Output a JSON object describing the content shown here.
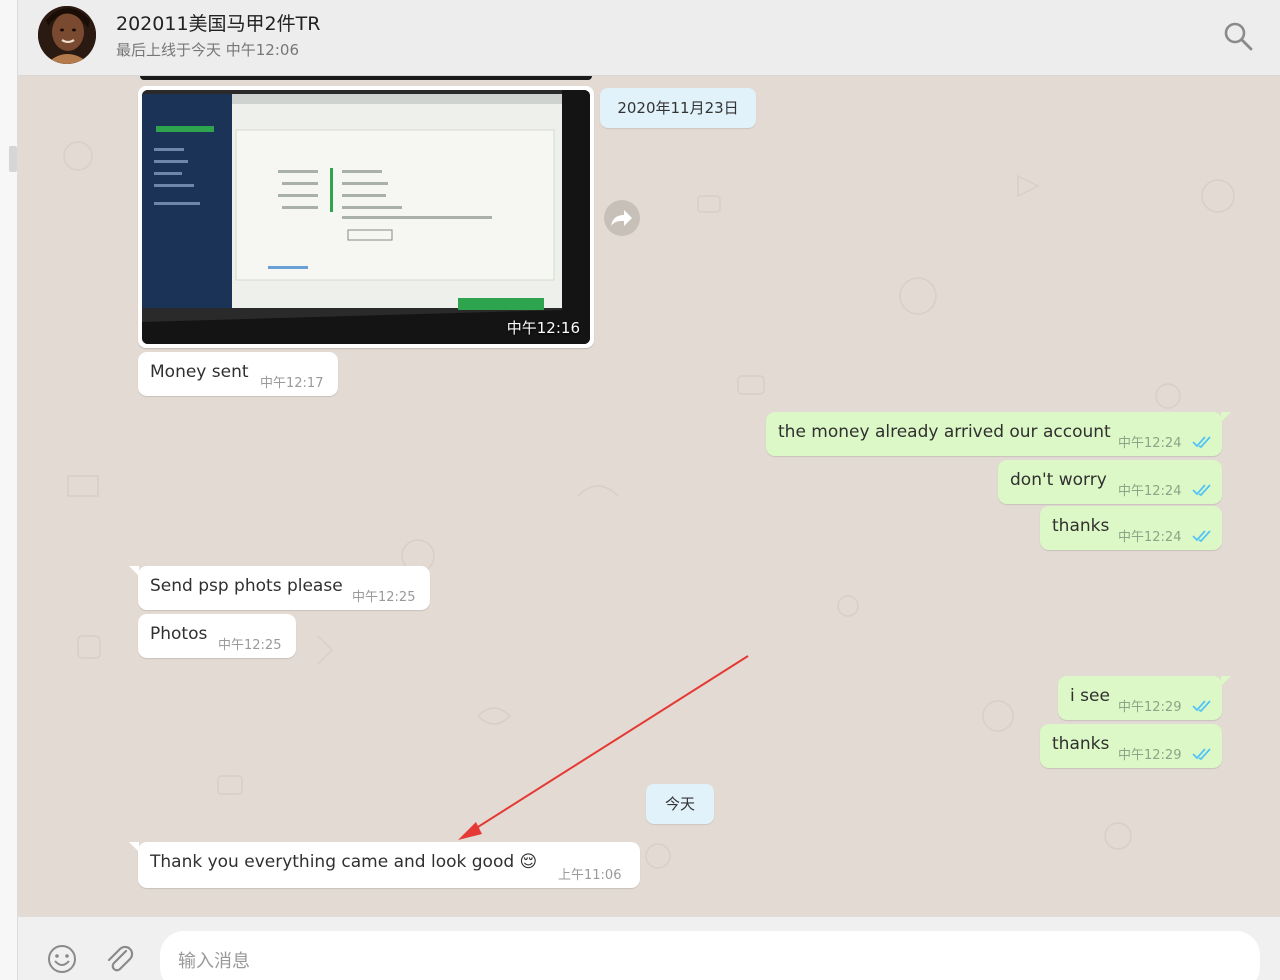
{
  "header": {
    "title": "202011美国马甲2件TR",
    "status": "最后上线于今天 中午12:06",
    "avatar_icon": "avatar-photo",
    "search_icon": "search-icon"
  },
  "messages": {
    "image_time": "中午12:16",
    "date1": "2020年11月23日",
    "m1_text": "Money sent",
    "m1_time": "中午12:17",
    "m2_text": "the money already arrived our account",
    "m2_time": "中午12:24",
    "m3_text": "don't worry",
    "m3_time": "中午12:24",
    "m4_text": "thanks",
    "m4_time": "中午12:24",
    "m5_text": "Send psp phots please",
    "m5_time": "中午12:25",
    "m6_text": "Photos",
    "m6_time": "中午12:25",
    "m7_text": "i see",
    "m7_time": "中午12:29",
    "m8_text": "thanks",
    "m8_time": "中午12:29",
    "date2": "今天",
    "m9_text": "Thank you everything came and look good 😌",
    "m9_time": "上午11:06"
  },
  "composer": {
    "placeholder": "输入消息",
    "emoji_icon": "emoji-icon",
    "attach_icon": "paperclip-icon"
  },
  "colors": {
    "chat_bg": "#e3dbd3",
    "incoming_bubble": "#ffffff",
    "outgoing_bubble": "#dcf8c6",
    "date_chip": "#e1f2fb",
    "read_ticks": "#4fc3f7",
    "annotation_arrow": "#e53935"
  }
}
